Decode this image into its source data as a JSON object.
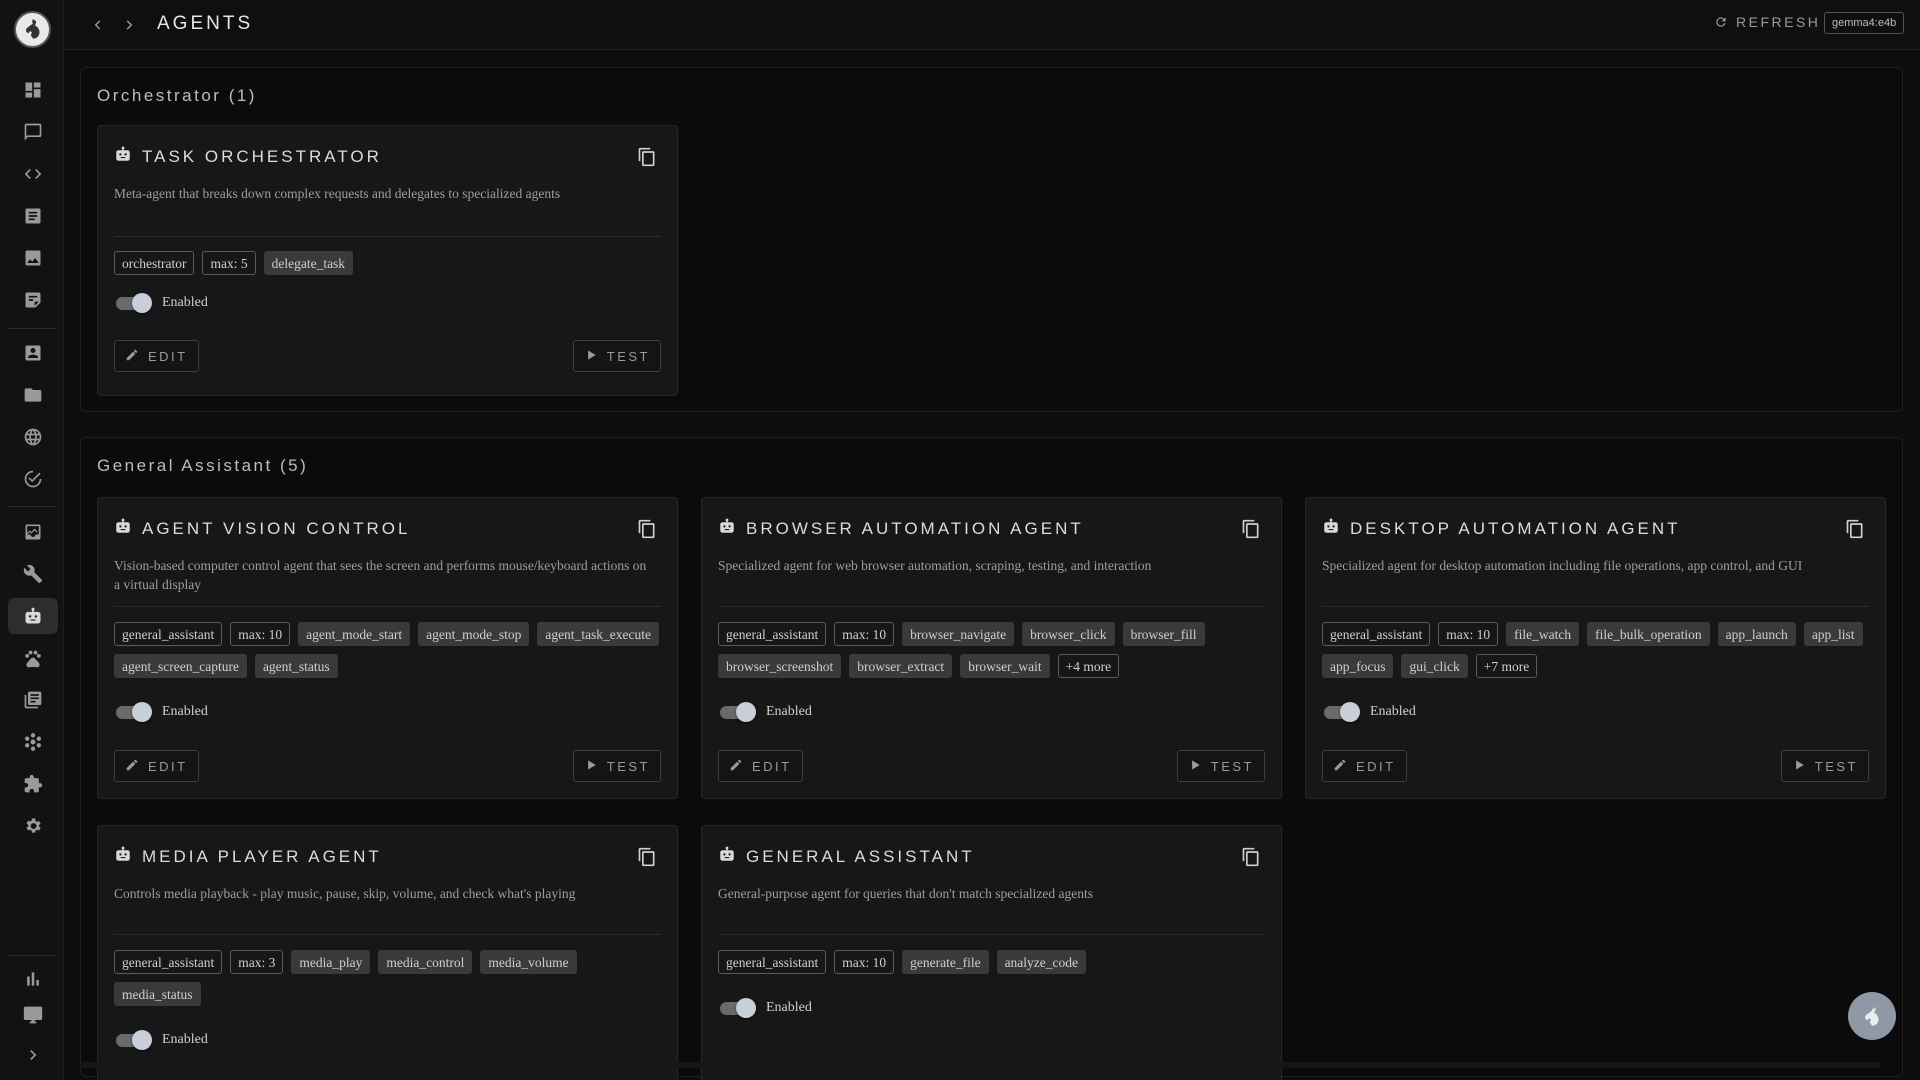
{
  "header": {
    "title": "AGENTS",
    "refresh_label": "REFRESH",
    "model": "gemma4:e4b"
  },
  "sidebar": {
    "icons": [
      "dashboard-icon",
      "chat-icon",
      "code-icon",
      "document-icon",
      "image-icon",
      "notes-icon",
      "contacts-icon",
      "folder-icon",
      "globe-icon",
      "check-circle-icon",
      "inbox-icon",
      "wrench-icon",
      "robot-icon",
      "paw-icon",
      "library-icon",
      "cluster-icon",
      "puzzle-icon",
      "gear-icon",
      "bar-chart-icon",
      "monitor-icon",
      "expand-icon"
    ],
    "active": "robot-icon"
  },
  "sections": [
    {
      "title": "Orchestrator (1)",
      "cards": [
        {
          "title": "TASK ORCHESTRATOR",
          "description": "Meta-agent that breaks down complex requests and delegates to specialized agents",
          "tags": [
            {
              "text": "orchestrator",
              "style": "outline"
            },
            {
              "text": "max: 5",
              "style": "outline"
            },
            {
              "text": "delegate_task",
              "style": "filled"
            }
          ],
          "enabled_label": "Enabled",
          "enabled": true,
          "edit_label": "EDIT",
          "test_label": "TEST"
        }
      ]
    },
    {
      "title": "General Assistant (5)",
      "cards": [
        {
          "title": "AGENT VISION CONTROL",
          "description": "Vision-based computer control agent that sees the screen and performs mouse/keyboard actions on a virtual display",
          "tags": [
            {
              "text": "general_assistant",
              "style": "outline"
            },
            {
              "text": "max: 10",
              "style": "outline"
            },
            {
              "text": "agent_mode_start",
              "style": "filled"
            },
            {
              "text": "agent_mode_stop",
              "style": "filled"
            },
            {
              "text": "agent_task_execute",
              "style": "filled"
            },
            {
              "text": "agent_screen_capture",
              "style": "filled"
            },
            {
              "text": "agent_status",
              "style": "filled"
            }
          ],
          "enabled_label": "Enabled",
          "enabled": true,
          "edit_label": "EDIT",
          "test_label": "TEST"
        },
        {
          "title": "BROWSER AUTOMATION AGENT",
          "description": "Specialized agent for web browser automation, scraping, testing, and interaction",
          "tags": [
            {
              "text": "general_assistant",
              "style": "outline"
            },
            {
              "text": "max: 10",
              "style": "outline"
            },
            {
              "text": "browser_navigate",
              "style": "filled"
            },
            {
              "text": "browser_click",
              "style": "filled"
            },
            {
              "text": "browser_fill",
              "style": "filled"
            },
            {
              "text": "browser_screenshot",
              "style": "filled"
            },
            {
              "text": "browser_extract",
              "style": "filled"
            },
            {
              "text": "browser_wait",
              "style": "filled"
            },
            {
              "text": "+4 more",
              "style": "outline"
            }
          ],
          "enabled_label": "Enabled",
          "enabled": true,
          "edit_label": "EDIT",
          "test_label": "TEST"
        },
        {
          "title": "DESKTOP AUTOMATION AGENT",
          "description": "Specialized agent for desktop automation including file operations, app control, and GUI",
          "tags": [
            {
              "text": "general_assistant",
              "style": "outline"
            },
            {
              "text": "max: 10",
              "style": "outline"
            },
            {
              "text": "file_watch",
              "style": "filled"
            },
            {
              "text": "file_bulk_operation",
              "style": "filled"
            },
            {
              "text": "app_launch",
              "style": "filled"
            },
            {
              "text": "app_list",
              "style": "filled"
            },
            {
              "text": "app_focus",
              "style": "filled"
            },
            {
              "text": "gui_click",
              "style": "filled"
            },
            {
              "text": "+7 more",
              "style": "outline"
            }
          ],
          "enabled_label": "Enabled",
          "enabled": true,
          "edit_label": "EDIT",
          "test_label": "TEST"
        },
        {
          "title": "MEDIA PLAYER AGENT",
          "description": "Controls media playback - play music, pause, skip, volume, and check what's playing",
          "tags": [
            {
              "text": "general_assistant",
              "style": "outline"
            },
            {
              "text": "max: 3",
              "style": "outline"
            },
            {
              "text": "media_play",
              "style": "filled"
            },
            {
              "text": "media_control",
              "style": "filled"
            },
            {
              "text": "media_volume",
              "style": "filled"
            },
            {
              "text": "media_status",
              "style": "filled"
            }
          ],
          "enabled_label": "Enabled",
          "enabled": true
        },
        {
          "title": "GENERAL ASSISTANT",
          "description": "General-purpose agent for queries that don't match specialized agents",
          "tags": [
            {
              "text": "general_assistant",
              "style": "outline"
            },
            {
              "text": "max: 10",
              "style": "outline"
            },
            {
              "text": "generate_file",
              "style": "filled"
            },
            {
              "text": "analyze_code",
              "style": "filled"
            }
          ],
          "enabled_label": "Enabled",
          "enabled": true
        }
      ]
    }
  ]
}
